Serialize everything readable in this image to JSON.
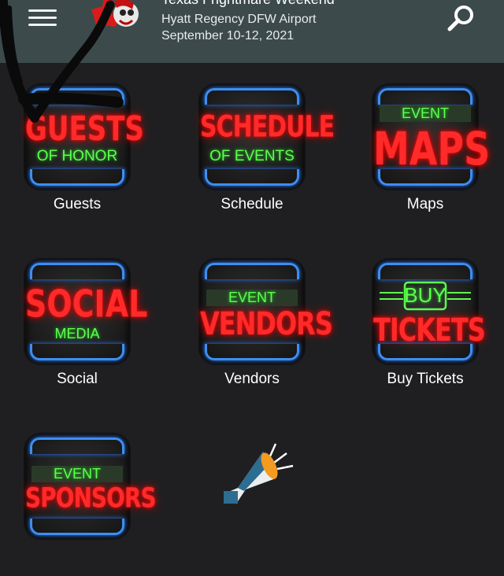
{
  "header": {
    "title": "Texas Frightmare Weekend",
    "venue": "Hyatt Regency DFW Airport",
    "dates": "September 10-12, 2021"
  },
  "tiles": [
    {
      "label": "Guests",
      "sign_top": "GUESTS",
      "sign_bottom": "OF HONOR"
    },
    {
      "label": "Schedule",
      "sign_top": "SCHEDULE",
      "sign_bottom": "OF EVENTS"
    },
    {
      "label": "Maps",
      "sign_top": "EVENT",
      "sign_bottom": "MAPS"
    },
    {
      "label": "Social",
      "sign_top": "SOCIAL",
      "sign_bottom": "MEDIA"
    },
    {
      "label": "Vendors",
      "sign_top": "EVENT",
      "sign_bottom": "VENDORS"
    },
    {
      "label": "Buy Tickets",
      "sign_top": "BUY",
      "sign_bottom": "TICKETS"
    },
    {
      "label": "",
      "sign_top": "EVENT",
      "sign_bottom": "SPONSORS"
    }
  ],
  "icons": {
    "menu": "hamburger-menu-icon",
    "search": "search-icon",
    "logo": "texas-frightmare-logo",
    "promo": "megaphone-icon"
  },
  "colors": {
    "header_bg": "#3c4a4b",
    "page_bg": "#1f1f21",
    "neon_red": "#ff2a2a",
    "neon_green": "#5dff4f",
    "neon_blue": "#3d8ef0"
  }
}
